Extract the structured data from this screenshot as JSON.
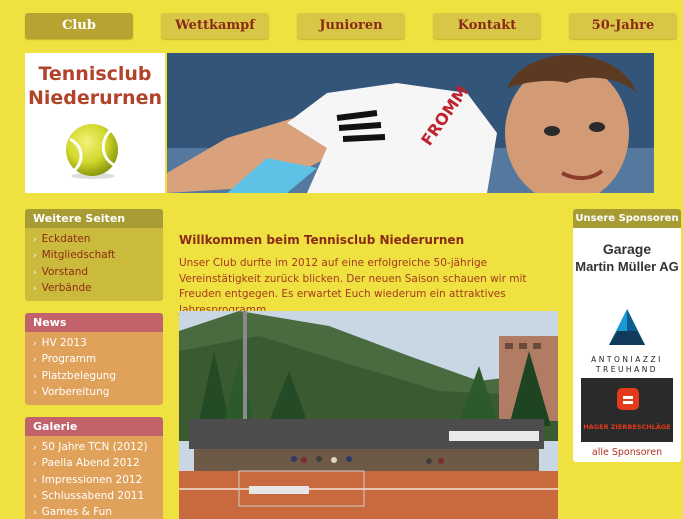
{
  "nav": {
    "items": [
      {
        "label": "Club",
        "active": true
      },
      {
        "label": "Wettkampf",
        "active": false
      },
      {
        "label": "Junioren",
        "active": false
      },
      {
        "label": "Kontakt",
        "active": false
      },
      {
        "label": "50-Jahre",
        "active": false
      }
    ]
  },
  "logo": {
    "line1": "Tennisclub",
    "line2": "Niederurnen",
    "icon": "tennis-ball-icon"
  },
  "banner": {
    "brand": "FROMM"
  },
  "sidebar": {
    "weitere": {
      "title": "Weitere Seiten",
      "items": [
        "Eckdaten",
        "Mitgliedschaft",
        "Vorstand",
        "Verbände"
      ]
    },
    "news": {
      "title": "News",
      "items": [
        "HV 2013",
        "Programm",
        "Platzbelegung",
        "Vorbereitung"
      ]
    },
    "galerie": {
      "title": "Galerie",
      "items": [
        "50 Jahre TCN (2012)",
        "Paella Abend 2012",
        "Impressionen 2012",
        "Schlussabend 2011",
        "Games & Fun"
      ]
    }
  },
  "main": {
    "heading": "Willkommen beim Tennisclub Niederurnen",
    "intro": "Unser Club durfte im 2012 auf eine erfolgreiche 50-jährige Vereinstätigkeit zurück blicken. Der neuen Saison schauen wir mit Freuden entgegen. Es erwartet Euch wiederum ein attraktives Jahresprogramm."
  },
  "sponsors": {
    "title": "Unsere Sponsoren",
    "garage_line1": "Garage",
    "garage_line2": "Martin Müller AG",
    "antoniazzi_line1": "ANTONIAZZI",
    "antoniazzi_line2": "TREUHAND",
    "hager": "HAGER ZIERBESCHLÄGE",
    "all_link": "alle Sponsoren"
  },
  "colors": {
    "page_bg": "#efe13f",
    "nav_button": "#d8c646",
    "nav_active": "#b6a332",
    "brand_red": "#b1432a"
  }
}
